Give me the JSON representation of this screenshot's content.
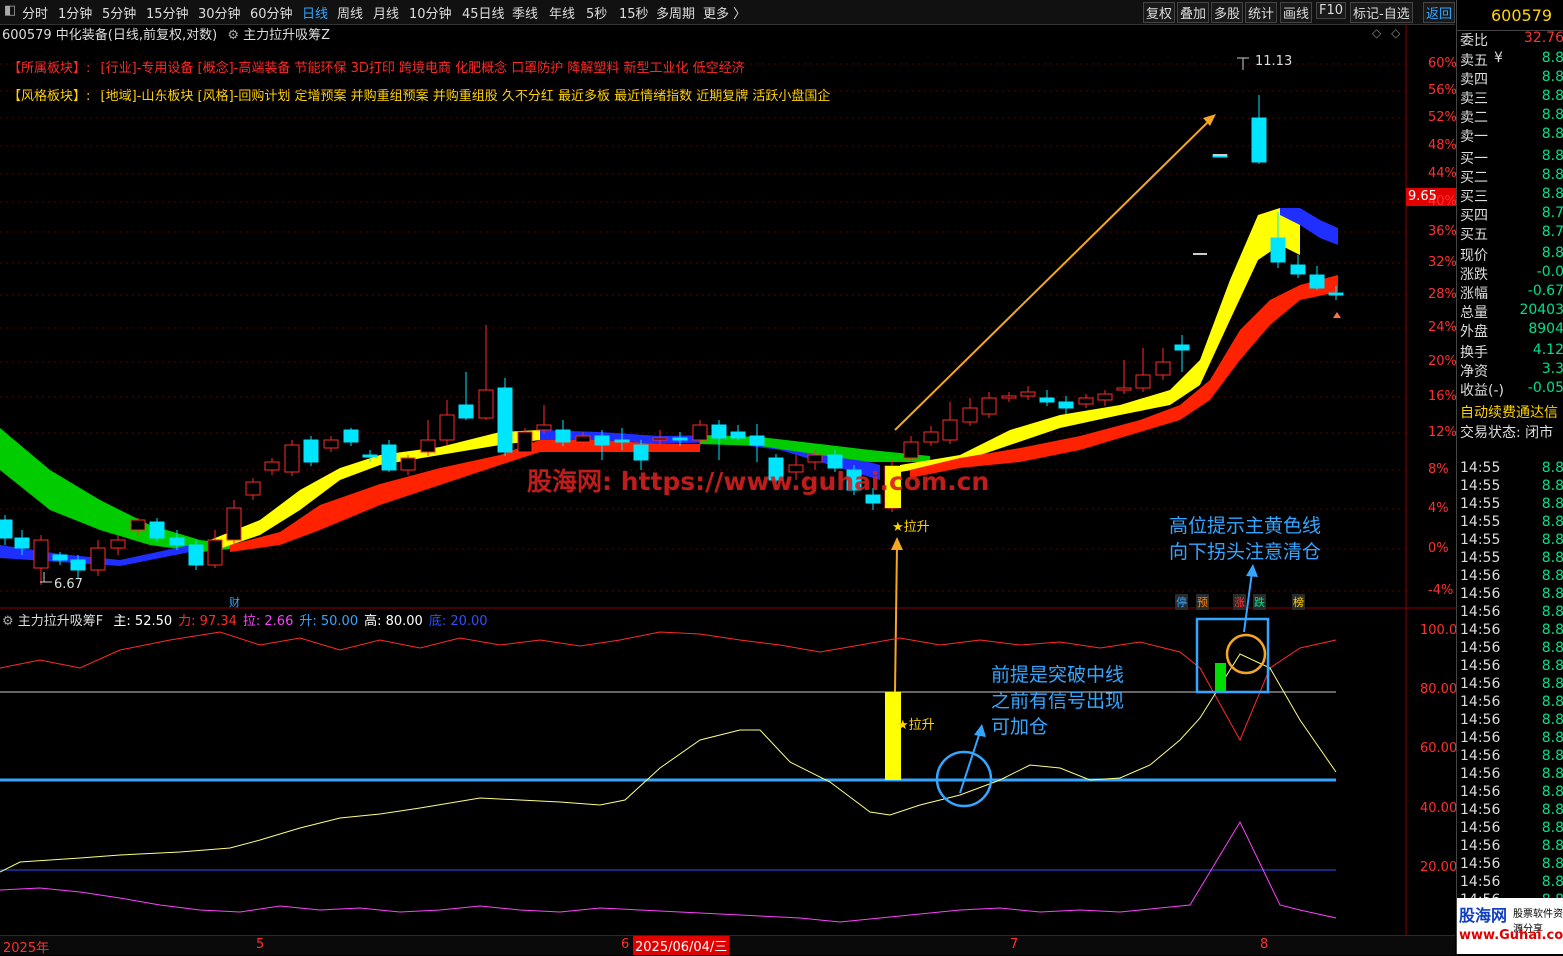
{
  "toolbar": {
    "periods": [
      "分时",
      "1分钟",
      "5分钟",
      "15分钟",
      "30分钟",
      "60分钟",
      "日线",
      "周线",
      "月线",
      "10分钟",
      "45日线",
      "季线",
      "年线",
      "5秒",
      "15秒",
      "多周期",
      "更多 〉"
    ],
    "active": "日线",
    "right_buttons": [
      "复权",
      "叠加",
      "多股",
      "统计",
      "画线",
      "F10",
      "标记-自选",
      "返回"
    ]
  },
  "chart_header": {
    "title": "600579 中化装备(日线,前复权,对数)",
    "indicator": "主力拉升吸筹Z"
  },
  "sector_line": {
    "label": "【所属板块】:",
    "text": "[行业]-专用设备 [概念]-高端装备 节能环保 3D打印 跨境电商 化肥概念 口罩防护 降解塑料 新型工业化 低空经济"
  },
  "style_line": {
    "label": "【风格板块】:",
    "text": "[地域]-山东板块 [风格]-回购计划 定增预案 并购重组预案 并购重组股 久不分红 最近多板 最近情绪指数 近期复牌 活跃小盘国企"
  },
  "price_axis": [
    "60%",
    "56%",
    "52%",
    "48%",
    "44%",
    "40%",
    "36%",
    "32%",
    "28%",
    "24%",
    "20%",
    "16%",
    "12%",
    "8%",
    "4%",
    "0%",
    "-4%"
  ],
  "current_price_tag": "9.65",
  "high_label": "11.13",
  "low_label": "6.67",
  "signal_label": "★拉升",
  "cai_label": "财",
  "event_tags": [
    "停",
    "预",
    "涨",
    "跌",
    "榜"
  ],
  "watermark": "股海网: https://www.guhai.com.cn",
  "indicator_header": {
    "name": "主力拉升吸筹F",
    "items": [
      {
        "label": "主: 52.50",
        "color": "#ffffff"
      },
      {
        "label": "力: 97.34",
        "color": "#ff2a2a"
      },
      {
        "label": "拉: 2.66",
        "color": "#ff40ff"
      },
      {
        "label": "升: 50.00",
        "color": "#34a6ff"
      },
      {
        "label": "高: 80.00",
        "color": "#ffffff"
      },
      {
        "label": "底: 20.00",
        "color": "#3050ff"
      }
    ]
  },
  "indicator_axis": [
    "100.00",
    "80.00",
    "60.00",
    "40.00",
    "20.00"
  ],
  "annotations": {
    "top": [
      "高位提示主黄色线",
      "向下拐头注意清仓"
    ],
    "mid": [
      "前提是突破中线",
      "之前有信号出现",
      "可加仓"
    ]
  },
  "date_axis": [
    "2025年",
    "5",
    "6",
    "2025/06/04/三",
    "7",
    "8"
  ],
  "right_panel": {
    "code": "600579",
    "weibi_label": "委比",
    "weibi_value": "32.76",
    "asks": [
      {
        "label": "卖五",
        "mark": "¥",
        "value": "8.8"
      },
      {
        "label": "卖四",
        "value": "8.8"
      },
      {
        "label": "卖三",
        "value": "8.8"
      },
      {
        "label": "卖二",
        "value": "8.8"
      },
      {
        "label": "卖一",
        "value": "8.8"
      }
    ],
    "bids": [
      {
        "label": "买一",
        "value": "8.8"
      },
      {
        "label": "买二",
        "value": "8.8"
      },
      {
        "label": "买三",
        "value": "8.8"
      },
      {
        "label": "买四",
        "value": "8.7"
      },
      {
        "label": "买五",
        "value": "8.7"
      }
    ],
    "quotes": [
      {
        "label": "现价",
        "value": "8.8"
      },
      {
        "label": "涨跌",
        "value": "-0.0"
      },
      {
        "label": "涨幅",
        "value": "-0.67"
      },
      {
        "label": "总量",
        "value": "20403"
      },
      {
        "label": "外盘",
        "value": "8904"
      }
    ],
    "quotes2": [
      {
        "label": "换手",
        "value": "4.12"
      },
      {
        "label": "净资",
        "value": "3.3"
      },
      {
        "label": "收益(-)",
        "value": "-0.05"
      }
    ],
    "notice": "自动续费通达信",
    "status": "交易状态: 闭市",
    "ticks": [
      {
        "t": "14:55",
        "v": "8.8"
      },
      {
        "t": "14:55",
        "v": "8.8"
      },
      {
        "t": "14:55",
        "v": "8.8"
      },
      {
        "t": "14:55",
        "v": "8.8"
      },
      {
        "t": "14:55",
        "v": "8.8"
      },
      {
        "t": "14:55",
        "v": "8.8"
      },
      {
        "t": "14:56",
        "v": "8.8"
      },
      {
        "t": "14:56",
        "v": "8.8"
      },
      {
        "t": "14:56",
        "v": "8.8"
      },
      {
        "t": "14:56",
        "v": "8.8"
      },
      {
        "t": "14:56",
        "v": "8.8"
      },
      {
        "t": "14:56",
        "v": "8.8"
      },
      {
        "t": "14:56",
        "v": "8.8"
      },
      {
        "t": "14:56",
        "v": "8.8"
      },
      {
        "t": "14:56",
        "v": "8.8"
      },
      {
        "t": "14:56",
        "v": "8.8"
      },
      {
        "t": "14:56",
        "v": "8.8"
      },
      {
        "t": "14:56",
        "v": "8.8"
      },
      {
        "t": "14:56",
        "v": "8.8"
      },
      {
        "t": "14:56",
        "v": "8.8"
      },
      {
        "t": "14:56",
        "v": "8.8"
      },
      {
        "t": "14:56",
        "v": "8.8"
      },
      {
        "t": "14:56",
        "v": "8.8"
      },
      {
        "t": "14:56",
        "v": "8.8"
      },
      {
        "t": "14:56",
        "v": "8.8"
      }
    ],
    "brand": "股海网",
    "brand_tagline": "股票软件资源分享",
    "brand_url": "www.Guhai.com.cn"
  },
  "colors": {
    "up": "#ff2a2a",
    "down": "#00e5ff",
    "accent": "#34a6ff",
    "ribbon_yellow": "#ffff00",
    "ribbon_red": "#ff2200",
    "ribbon_green": "#00cc00",
    "ribbon_blue": "#1f2fff"
  }
}
